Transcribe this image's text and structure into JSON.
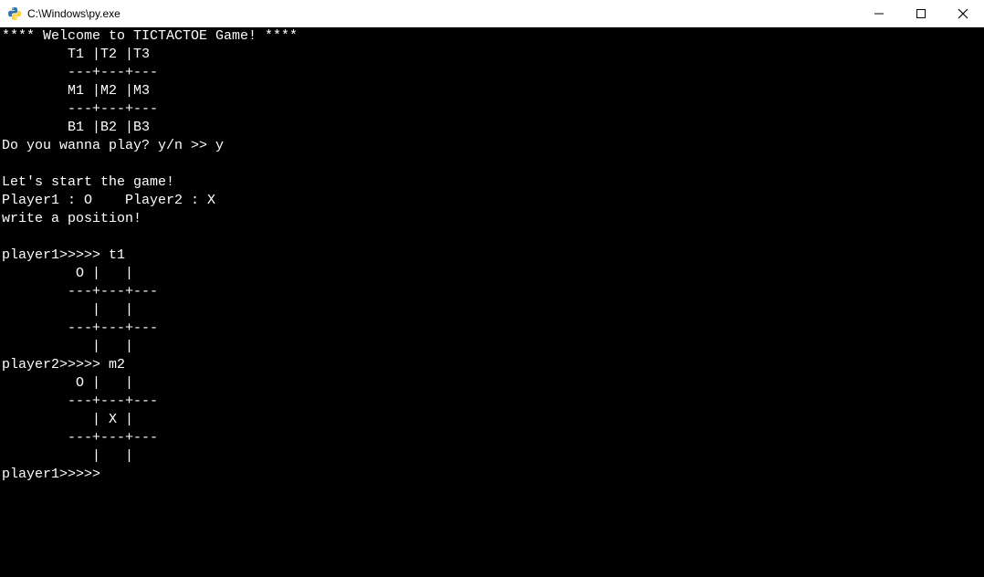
{
  "window": {
    "title": "C:\\Windows\\py.exe"
  },
  "terminal": {
    "lines": [
      "**** Welcome to TICTACTOE Game! ****",
      "        T1 |T2 |T3",
      "        ---+---+---",
      "        M1 |M2 |M3",
      "        ---+---+---",
      "        B1 |B2 |B3",
      "Do you wanna play? y/n >> y",
      "",
      "Let's start the game!",
      "Player1 : O    Player2 : X",
      "write a position!",
      "",
      "player1>>>>> t1",
      "         O |   |",
      "        ---+---+---",
      "           |   |",
      "        ---+---+---",
      "           |   |",
      "player2>>>>> m2",
      "         O |   |",
      "        ---+---+---",
      "           | X |",
      "        ---+---+---",
      "           |   |",
      "player1>>>>>"
    ]
  }
}
